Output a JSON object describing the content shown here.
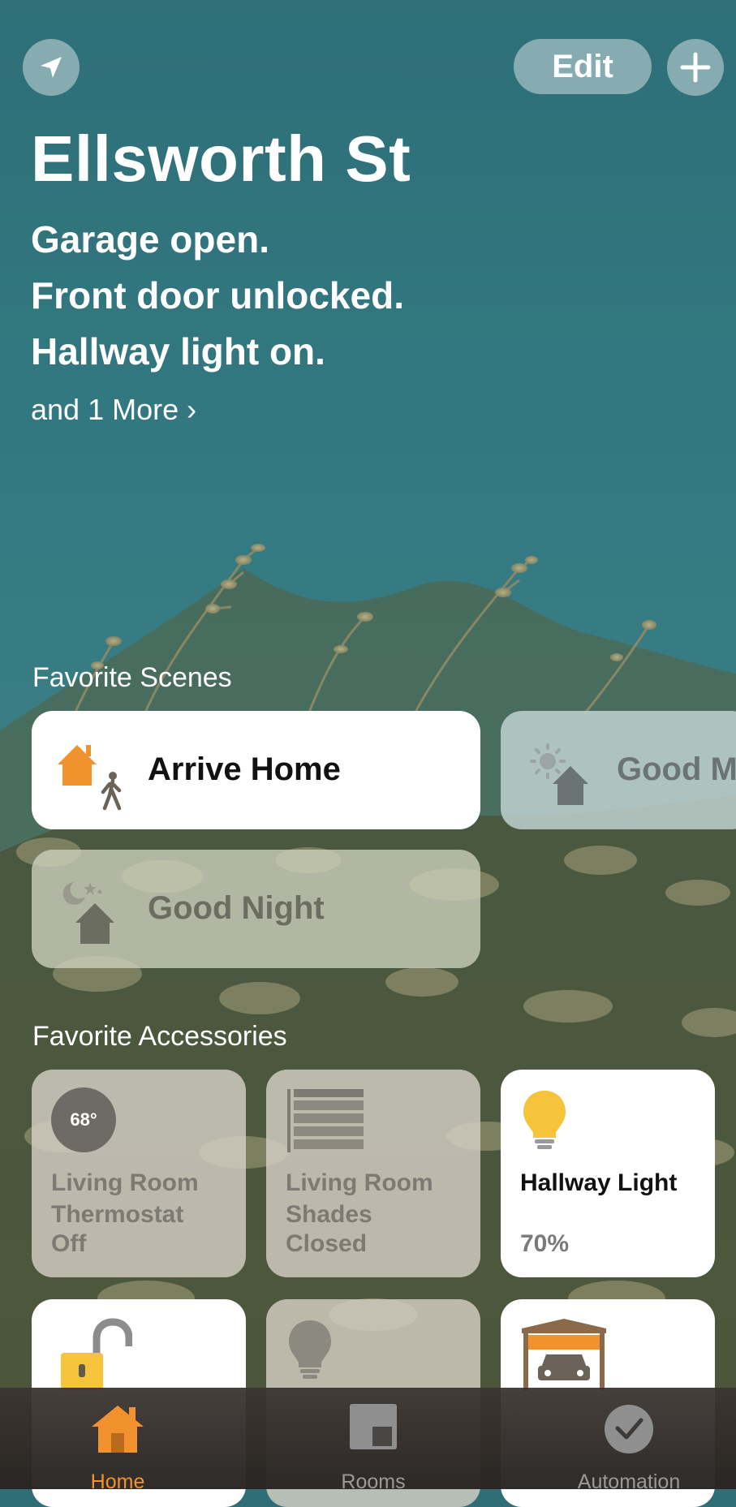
{
  "header": {
    "edit_label": "Edit",
    "home_name": "Ellsworth St",
    "status_lines": [
      "Garage open.",
      "Front door unlocked.",
      "Hallway light on."
    ],
    "more_link": "and 1 More ›"
  },
  "scenes": {
    "section_label": "Favorite Scenes",
    "items": [
      {
        "label": "Arrive Home",
        "icon": "arrive-home-icon",
        "active": true
      },
      {
        "label": "Good M",
        "icon": "good-morning-icon",
        "active": false
      },
      {
        "label": "Good Night",
        "icon": "good-night-icon",
        "active": false
      }
    ]
  },
  "accessories": {
    "section_label": "Favorite Accessories",
    "items": [
      {
        "badge": "68°",
        "name": "Living Room Thermostat",
        "state": "Off",
        "icon": "thermostat-icon",
        "on": false
      },
      {
        "name": "Living Room Shades",
        "state": "Closed",
        "icon": "shades-icon",
        "on": false
      },
      {
        "name": "Hallway Light",
        "state": "70%",
        "icon": "lightbulb-icon",
        "on": true,
        "brightness": 0.7
      },
      {
        "name": "",
        "state": "",
        "icon": "unlocked-padlock-icon",
        "on": true
      },
      {
        "name": "",
        "state": "",
        "icon": "lightbulb-off-icon",
        "on": false
      },
      {
        "name": "",
        "state": "",
        "icon": "garage-open-icon",
        "on": true
      }
    ]
  },
  "tabbar": {
    "tabs": [
      {
        "label": "Home",
        "icon": "home-icon",
        "selected": true
      },
      {
        "label": "Rooms",
        "icon": "rooms-icon",
        "selected": false
      },
      {
        "label": "Automation",
        "icon": "automation-icon",
        "selected": false
      }
    ]
  },
  "colors": {
    "accent": "#f2922e",
    "wall": "#2f6e76",
    "tab_inactive": "#9a9a9a",
    "bulb_on": "#f5c43b"
  }
}
